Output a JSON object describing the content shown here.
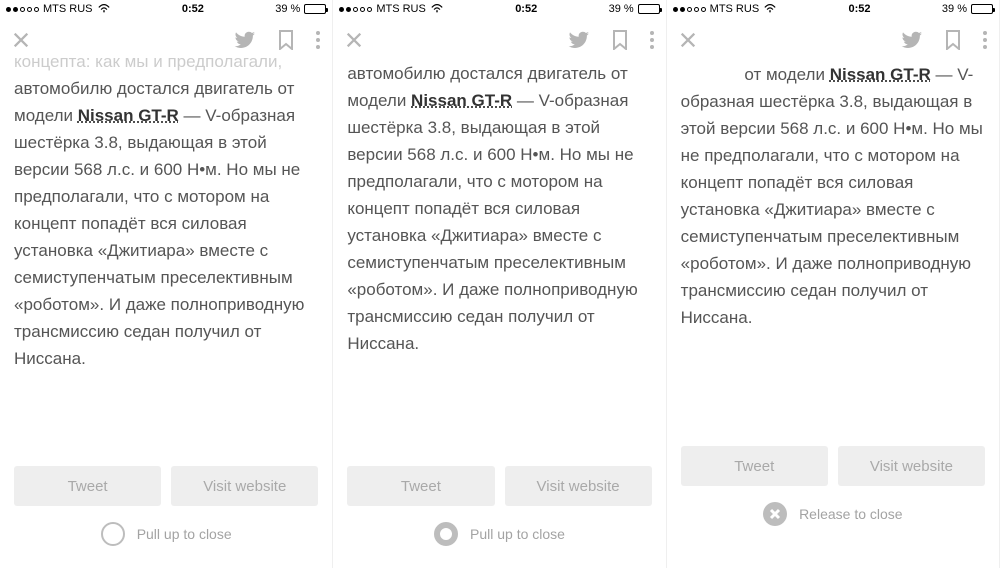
{
  "status": {
    "carrier": "MTS RUS",
    "time": "0:52",
    "battery_pct": "39 %"
  },
  "article": {
    "line_a": "концепта: как мы и предполагали,",
    "text_pre": "автомобилю достался двигатель от модели ",
    "link_text": "Nissan GT-R",
    "text_post": " — V-образная шестёрка 3.8, выдающая в этой версии 568 л.с. и 600 Н•м. Но мы не предполагали, что с мотором на концепт попадёт вся силовая установка «Джитиара» вместе с семиступенчатым преселективным «роботом». И даже полноприводную трансмиссию седан получил от Ниссана."
  },
  "buttons": {
    "tweet": "Tweet",
    "visit": "Visit website"
  },
  "pull": {
    "up": "Pull up to close",
    "release": "Release to close"
  }
}
